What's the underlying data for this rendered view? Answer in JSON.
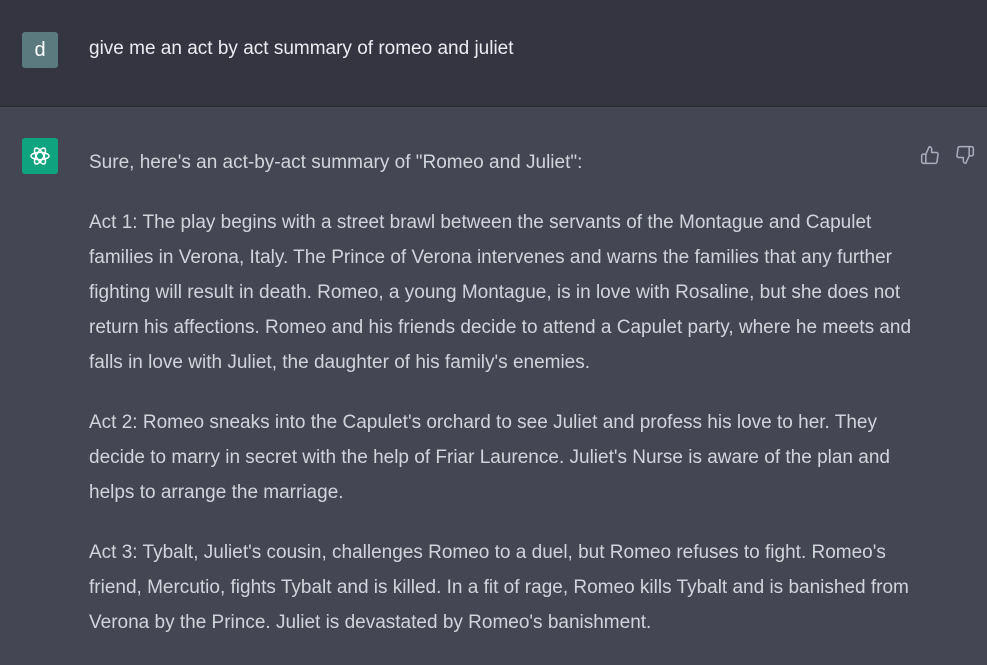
{
  "user": {
    "avatar_letter": "d",
    "message": "give me an act by act summary of romeo and juliet"
  },
  "assistant": {
    "intro": "Sure, here's an act-by-act summary of \"Romeo and Juliet\":",
    "acts": [
      "Act 1: The play begins with a street brawl between the servants of the Montague and Capulet families in Verona, Italy. The Prince of Verona intervenes and warns the families that any further fighting will result in death. Romeo, a young Montague, is in love with Rosaline, but she does not return his affections. Romeo and his friends decide to attend a Capulet party, where he meets and falls in love with Juliet, the daughter of his family's enemies.",
      "Act 2: Romeo sneaks into the Capulet's orchard to see Juliet and profess his love to her. They decide to marry in secret with the help of Friar Laurence. Juliet's Nurse is aware of the plan and helps to arrange the marriage.",
      "Act 3: Tybalt, Juliet's cousin, challenges Romeo to a duel, but Romeo refuses to fight. Romeo's friend, Mercutio, fights Tybalt and is killed. In a fit of rage, Romeo kills Tybalt and is banished from Verona by the Prince. Juliet is devastated by Romeo's banishment."
    ]
  },
  "icons": {
    "bot_avatar": "openai-logo-icon",
    "thumbs_up": "thumbs-up-icon",
    "thumbs_down": "thumbs-down-icon"
  },
  "colors": {
    "user_bg": "#343541",
    "assistant_bg": "#444654",
    "bot_avatar_bg": "#10a37f",
    "user_avatar_bg": "#5b7a80",
    "text": "#d1d5db"
  }
}
